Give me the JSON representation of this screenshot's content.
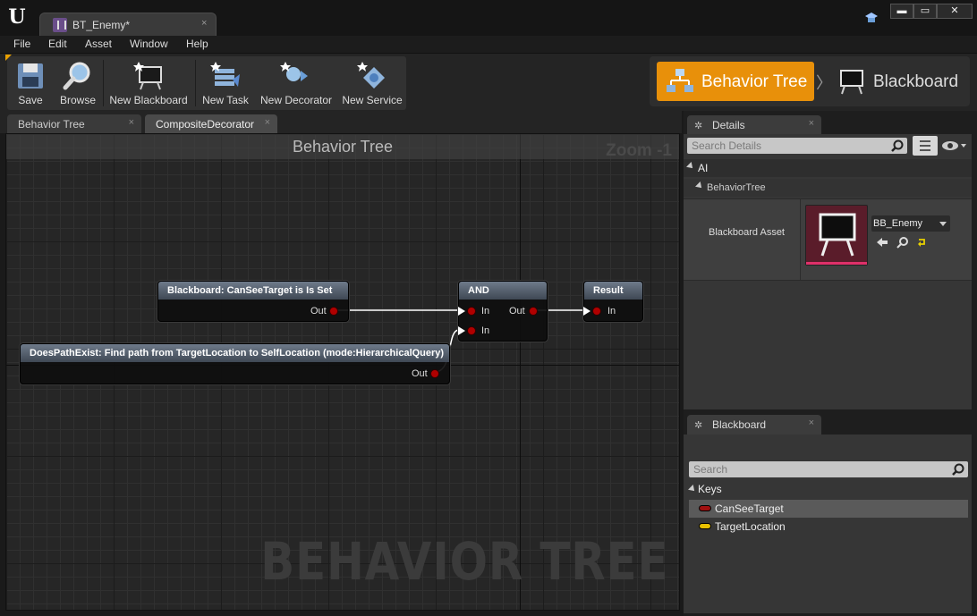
{
  "window": {
    "tab_title": "BT_Enemy*",
    "tab_close": "×",
    "controls": {
      "minimize": "▬",
      "maximize": "▭",
      "close": "✕"
    }
  },
  "menu": [
    "File",
    "Edit",
    "Asset",
    "Window",
    "Help"
  ],
  "toolbar": {
    "save": "Save",
    "browse": "Browse",
    "new_blackboard": "New Blackboard",
    "new_task": "New Task",
    "new_decorator": "New Decorator",
    "new_service": "New Service"
  },
  "modes": {
    "behavior_tree": "Behavior Tree",
    "separator": "〉",
    "blackboard": "Blackboard",
    "active": "behavior_tree",
    "active_color": "#e8900a"
  },
  "graph_tabs": [
    {
      "label": "Behavior Tree",
      "close": "×"
    },
    {
      "label": "CompositeDecorator",
      "close": "×",
      "active": true
    }
  ],
  "graph": {
    "title": "Behavior Tree",
    "zoom": "Zoom -1",
    "watermark": "BEHAVIOR TREE",
    "nodes": {
      "blackboard_node": {
        "title": "Blackboard: CanSeeTarget is Is Set",
        "out": "Out"
      },
      "pathexist_node": {
        "title": "DoesPathExist: Find path from TargetLocation to SelfLocation (mode:HierarchicalQuery)",
        "out": "Out"
      },
      "and_node": {
        "title": "AND",
        "in1": "In",
        "in2": "In",
        "out": "Out"
      },
      "result_node": {
        "title": "Result",
        "in": "In"
      }
    },
    "pin_color": "#b00000",
    "wire_color": "#ffffff"
  },
  "details": {
    "tab_label": "Details",
    "tab_close": "×",
    "search_placeholder": "Search Details",
    "category": "AI",
    "subcategory": "BehaviorTree",
    "property_name": "Blackboard Asset",
    "asset_value": "BB_Enemy"
  },
  "blackboard_panel": {
    "tab_label": "Blackboard",
    "tab_close": "×",
    "search_placeholder": "Search",
    "category": "Keys",
    "keys": [
      {
        "name": "CanSeeTarget",
        "color": "#a01010",
        "selected": true
      },
      {
        "name": "TargetLocation",
        "color": "#e8c000",
        "selected": false
      }
    ]
  }
}
